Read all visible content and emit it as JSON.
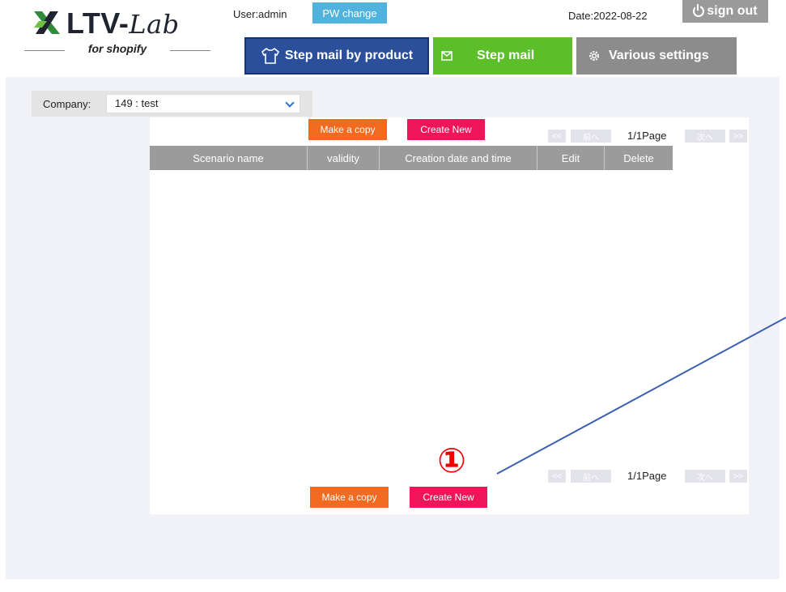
{
  "header": {
    "logo_main": "LTV-",
    "logo_lab": "Lab",
    "logo_sub": "for shopify",
    "user_label": "User:admin",
    "pw_change": "PW change",
    "date_label": "Date:2022-08-22",
    "sign_out": "sign out"
  },
  "tabs": [
    {
      "label": "Step mail by product",
      "icon": "shirt-icon",
      "color": "#2c4f9c",
      "active": true
    },
    {
      "label": "Step mail",
      "icon": "envelope-icon",
      "color": "#5cbf2a",
      "active": false
    },
    {
      "label": "Various settings",
      "icon": "gear-icon",
      "color": "#8c8c8c",
      "active": false
    }
  ],
  "filter": {
    "company_label": "Company:",
    "company_value": "149 : test"
  },
  "actions": {
    "make_copy": "Make a copy",
    "create_new": "Create New"
  },
  "pager": {
    "first": "<<",
    "prev": "前へ",
    "page_text": "1/1Page",
    "next": "次へ",
    "last": ">>"
  },
  "table": {
    "columns": [
      "Scenario name",
      "validity",
      "Creation date and time",
      "Edit",
      "Delete"
    ],
    "rows": []
  },
  "annotation": {
    "marker": "①",
    "color": "#e00000",
    "line_color": "#3a5fb0"
  },
  "colors": {
    "copy_button": "#f26a1f",
    "create_button": "#f0145a",
    "pw_button": "#4fb3dd",
    "signout_button": "#9a9a9a"
  }
}
